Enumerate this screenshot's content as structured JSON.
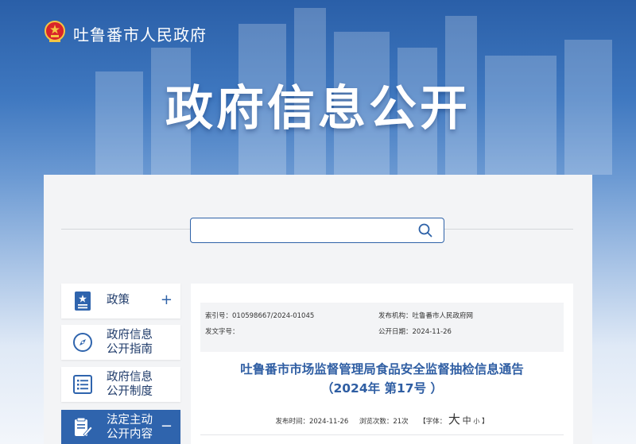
{
  "header": {
    "site_name": "吐鲁番市人民政府",
    "banner_title": "政府信息公开"
  },
  "search": {
    "placeholder": "",
    "icon": "search-icon"
  },
  "sidebar": {
    "items": [
      {
        "label": "政策",
        "icon": "policy-doc-icon",
        "state": "collapsed",
        "toggle": "+"
      },
      {
        "label": "政府信息公开指南",
        "line1": "政府信息",
        "line2": "公开指南",
        "icon": "compass-icon"
      },
      {
        "label": "政府信息公开制度",
        "line1": "政府信息",
        "line2": "公开制度",
        "icon": "list-icon"
      },
      {
        "label": "法定主动公开内容",
        "line1": "法定主动",
        "line2": "公开内容",
        "icon": "edit-doc-icon",
        "state": "expanded",
        "toggle": "−"
      }
    ],
    "active_color": "#2f64ad"
  },
  "document": {
    "meta": {
      "index_label": "索引号：010598667/2024-01045",
      "publisher_label": "发布机构：吐鲁番市人民政府网",
      "doc_number_label": "发文字号：",
      "public_date_label": "公开日期：2024-11-26"
    },
    "title_line1": "吐鲁番市市场监督管理局食品安全监督抽检信息通告",
    "title_line2": "（2024年 第17号 ）",
    "info": {
      "publish_time": "发布时间：2024-11-26",
      "views": "浏览次数：21次",
      "font_label_open": "【字体：",
      "font_large": "大",
      "font_medium": "中",
      "font_small": "小",
      "font_label_close": "】"
    },
    "title_color": "#2f5ea3"
  }
}
